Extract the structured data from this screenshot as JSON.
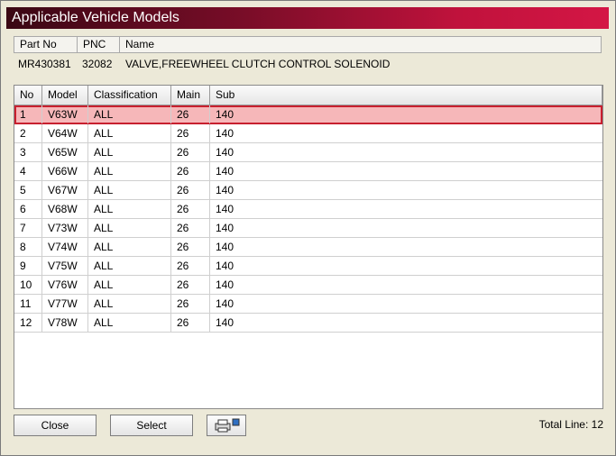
{
  "window": {
    "title": "Applicable Vehicle Models"
  },
  "part_header": {
    "part_no": "Part No",
    "pnc": "PNC",
    "name": "Name"
  },
  "part": {
    "part_no": "MR430381",
    "pnc": "32082",
    "name": "VALVE,FREEWHEEL CLUTCH CONTROL SOLENOID"
  },
  "grid": {
    "columns": {
      "no": "No",
      "model": "Model",
      "classification": "Classification",
      "main": "Main",
      "sub": "Sub"
    },
    "rows": [
      {
        "no": "1",
        "model": "V63W",
        "classification": "ALL",
        "main": "26",
        "sub": "140"
      },
      {
        "no": "2",
        "model": "V64W",
        "classification": "ALL",
        "main": "26",
        "sub": "140"
      },
      {
        "no": "3",
        "model": "V65W",
        "classification": "ALL",
        "main": "26",
        "sub": "140"
      },
      {
        "no": "4",
        "model": "V66W",
        "classification": "ALL",
        "main": "26",
        "sub": "140"
      },
      {
        "no": "5",
        "model": "V67W",
        "classification": "ALL",
        "main": "26",
        "sub": "140"
      },
      {
        "no": "6",
        "model": "V68W",
        "classification": "ALL",
        "main": "26",
        "sub": "140"
      },
      {
        "no": "7",
        "model": "V73W",
        "classification": "ALL",
        "main": "26",
        "sub": "140"
      },
      {
        "no": "8",
        "model": "V74W",
        "classification": "ALL",
        "main": "26",
        "sub": "140"
      },
      {
        "no": "9",
        "model": "V75W",
        "classification": "ALL",
        "main": "26",
        "sub": "140"
      },
      {
        "no": "10",
        "model": "V76W",
        "classification": "ALL",
        "main": "26",
        "sub": "140"
      },
      {
        "no": "11",
        "model": "V77W",
        "classification": "ALL",
        "main": "26",
        "sub": "140"
      },
      {
        "no": "12",
        "model": "V78W",
        "classification": "ALL",
        "main": "26",
        "sub": "140"
      }
    ],
    "selected_row": 0
  },
  "footer": {
    "close_label": "Close",
    "select_label": "Select",
    "print_icon": "printer-icon",
    "total_line": "Total Line: 12"
  },
  "colors": {
    "title_dark": "#3a0714",
    "title_light": "#d41645",
    "selected_fill": "#f6b7b9",
    "selected_border": "#c8202f"
  }
}
